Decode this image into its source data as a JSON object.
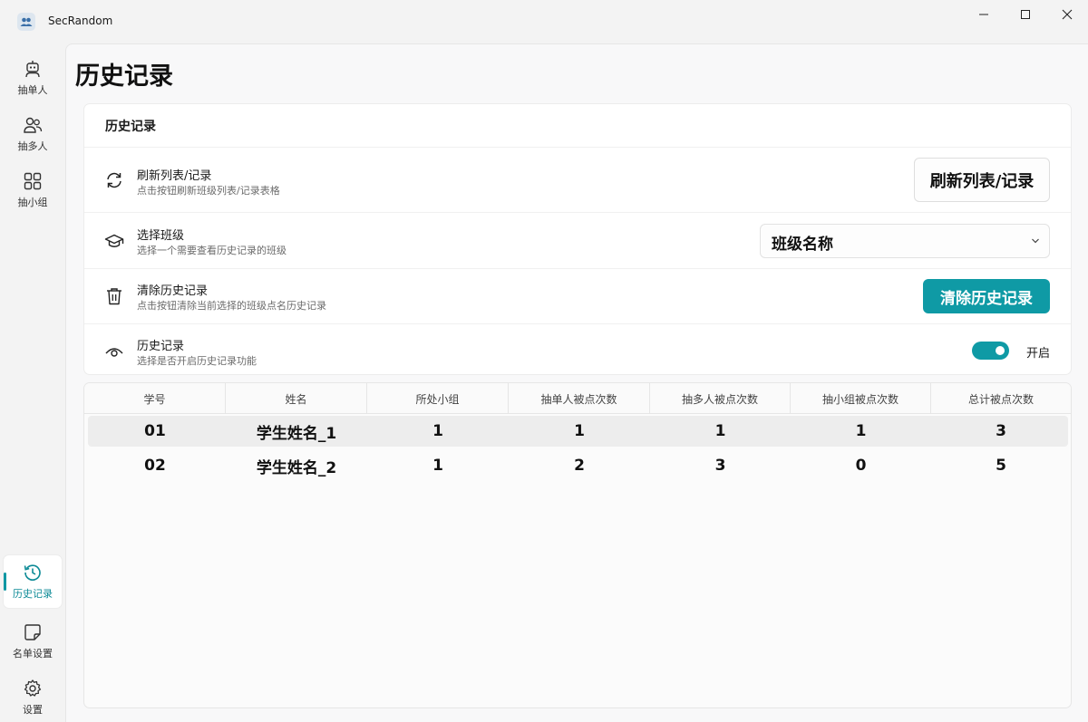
{
  "app": {
    "title": "SecRandom"
  },
  "window_controls": {
    "minimize_icon": "minimize-icon",
    "maximize_icon": "maximize-icon",
    "close_icon": "close-icon"
  },
  "sidebar": {
    "top_items": [
      {
        "label": "抽单人",
        "icon": "robot-icon"
      },
      {
        "label": "抽多人",
        "icon": "people-icon"
      },
      {
        "label": "抽小组",
        "icon": "grid-icon"
      }
    ],
    "bottom_items": [
      {
        "label": "历史记录",
        "icon": "history-icon",
        "active": true
      },
      {
        "label": "名单设置",
        "icon": "note-icon"
      },
      {
        "label": "设置",
        "icon": "gear-icon"
      }
    ]
  },
  "page": {
    "title": "历史记录"
  },
  "settings_card": {
    "title": "历史记录",
    "refresh": {
      "title": "刷新列表/记录",
      "description": "点击按钮刷新班级列表/记录表格",
      "button_label": "刷新列表/记录"
    },
    "class_select": {
      "title": "选择班级",
      "description": "选择一个需要查看历史记录的班级",
      "selected": "班级名称"
    },
    "clear": {
      "title": "清除历史记录",
      "description": "点击按钮清除当前选择的班级点名历史记录",
      "button_label": "清除历史记录"
    },
    "history_toggle": {
      "title": "历史记录",
      "description": "选择是否开启历史记录功能",
      "state_label": "开启",
      "on": true
    }
  },
  "table": {
    "columns": [
      "学号",
      "姓名",
      "所处小组",
      "抽单人被点次数",
      "抽多人被点次数",
      "抽小组被点次数",
      "总计被点次数"
    ],
    "rows": [
      [
        "01",
        "学生姓名_1",
        "1",
        "1",
        "1",
        "1",
        "3"
      ],
      [
        "02",
        "学生姓名_2",
        "1",
        "2",
        "3",
        "0",
        "5"
      ]
    ],
    "selected_row": 0
  },
  "colors": {
    "accent": "#0f9aa5"
  }
}
